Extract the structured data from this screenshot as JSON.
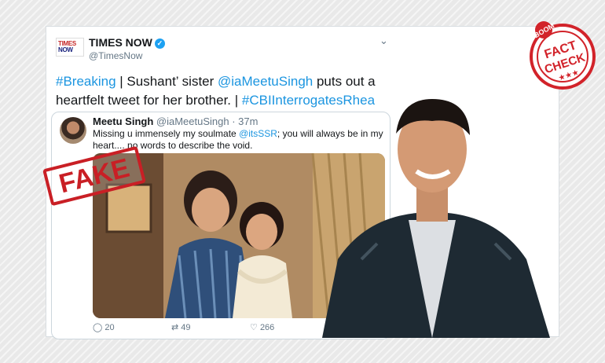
{
  "account": {
    "name": "TIMES NOW",
    "handle": "@TimesNow",
    "logo_line1": "TIMES",
    "logo_line2": "NOW"
  },
  "tweet": {
    "hashtag_breaking": "#Breaking",
    "separator": " | Sushant’ sister ",
    "mention": "@iaMeetuSingh",
    "text_rest": " puts out a heartfelt tweet for her brother. | ",
    "hashtag_cbi": "#CBIInterrogatesRhea"
  },
  "quoted_tweet": {
    "name": "Meetu Singh",
    "handle_time": "@iaMeetuSingh · 37m",
    "text_before": "Missing u immensely  my soulmate ",
    "mention": "@itsSSR",
    "text_after": "; you will always be in my heart.... no words to describe the void.",
    "reply_count": "20",
    "retweet_count": "49",
    "like_count": "266"
  },
  "stamp": {
    "label": "FAKE"
  },
  "badge": {
    "top": "BOOM",
    "line1": "FACT",
    "line2": "CHECK"
  },
  "colors": {
    "link": "#1b95e0",
    "stamp_red": "#c91f25",
    "verified": "#1da1f2"
  }
}
